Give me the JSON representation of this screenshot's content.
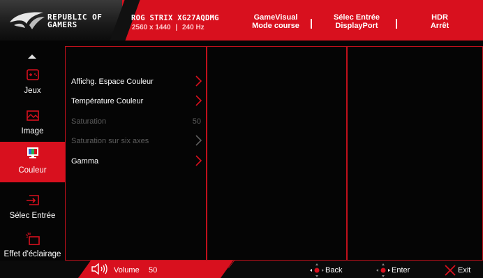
{
  "header": {
    "brand_line1": "REPUBLIC OF",
    "brand_line2": "GAMERS",
    "model": "ROG STRIX XG27AQDMG",
    "resolution": "2560 x 1440",
    "refresh": "240 Hz",
    "gamevisual_label": "GameVisual",
    "gamevisual_value": "Mode course",
    "input_label": "Sélec Entrée",
    "input_value": "DisplayPort",
    "hdr_label": "HDR",
    "hdr_value": "Arrêt"
  },
  "sidebar": {
    "items": [
      {
        "label": "Jeux",
        "icon": "gamepad-icon",
        "active": false
      },
      {
        "label": "Image",
        "icon": "image-icon",
        "active": false
      },
      {
        "label": "Couleur",
        "icon": "color-icon",
        "active": true
      },
      {
        "label": "Sélec Entrée",
        "icon": "input-icon",
        "active": false
      },
      {
        "label": "Effet d'éclairage",
        "icon": "lighting-icon",
        "active": false
      }
    ]
  },
  "menu": {
    "items": [
      {
        "label": "Affichg. Espace Couleur",
        "enabled": true,
        "has_submenu": true
      },
      {
        "label": "Température Couleur",
        "enabled": true,
        "has_submenu": true
      },
      {
        "label": "Saturation",
        "enabled": false,
        "value": "50"
      },
      {
        "label": "Saturation sur six axes",
        "enabled": false,
        "has_submenu": true
      },
      {
        "label": "Gamma",
        "enabled": true,
        "has_submenu": true
      }
    ]
  },
  "footer": {
    "volume_label": "Volume",
    "volume_value": "50",
    "back_label": "Back",
    "enter_label": "Enter",
    "exit_label": "Exit"
  },
  "colors": {
    "accent": "#d8101e",
    "text": "#ffffff",
    "disabled": "#5e5e5e",
    "background": "#050505"
  }
}
